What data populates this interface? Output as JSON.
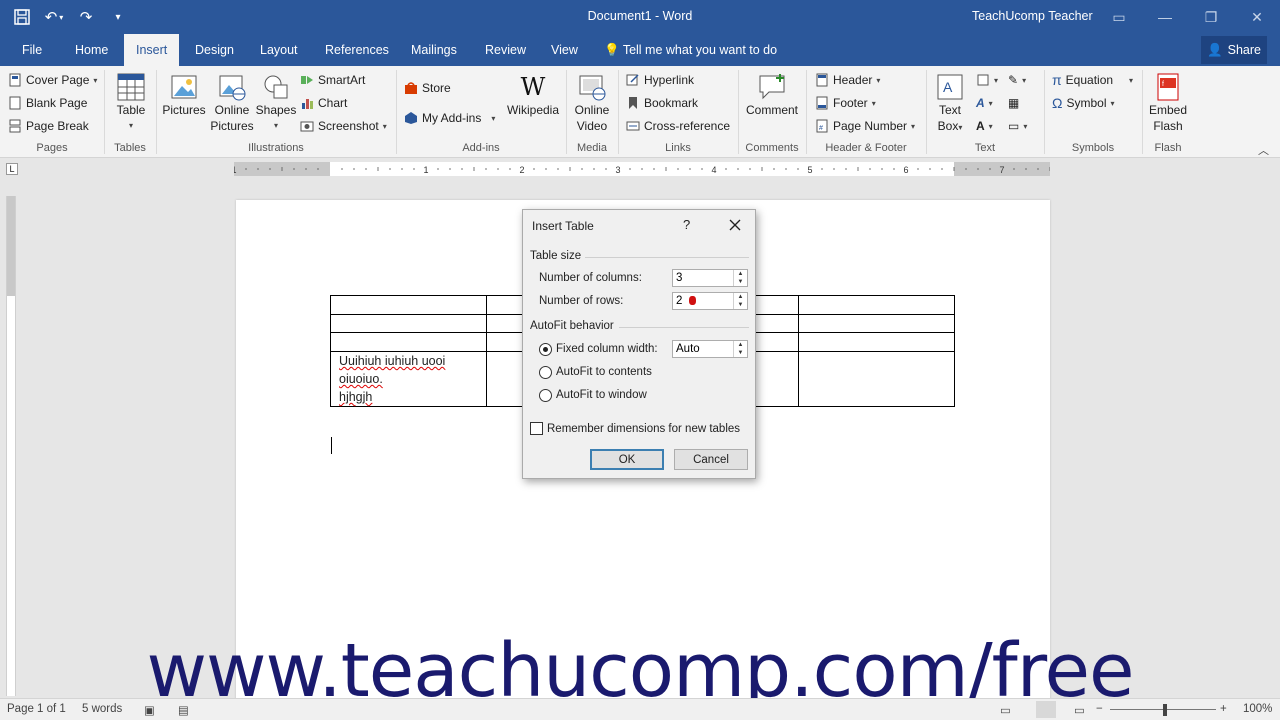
{
  "window": {
    "doc_title": "Document1 - Word",
    "user": "TeachUcomp Teacher"
  },
  "tabs": [
    "File",
    "Home",
    "Insert",
    "Design",
    "Layout",
    "References",
    "Mailings",
    "Review",
    "View"
  ],
  "active_tab": "Insert",
  "tell_me": "Tell me what you want to do",
  "share": "Share",
  "ribbon": {
    "pages": {
      "label": "Pages",
      "cover_page": "Cover Page",
      "blank_page": "Blank Page",
      "page_break": "Page Break"
    },
    "tables": {
      "label": "Tables",
      "table": "Table"
    },
    "illustrations": {
      "label": "Illustrations",
      "pictures": "Pictures",
      "online_pictures_1": "Online",
      "online_pictures_2": "Pictures",
      "shapes": "Shapes",
      "smartart": "SmartArt",
      "chart": "Chart",
      "screenshot": "Screenshot"
    },
    "addins": {
      "label": "Add-ins",
      "store": "Store",
      "my_addins": "My Add-ins",
      "wikipedia": "Wikipedia"
    },
    "media": {
      "label": "Media",
      "online_video_1": "Online",
      "online_video_2": "Video"
    },
    "links": {
      "label": "Links",
      "hyperlink": "Hyperlink",
      "bookmark": "Bookmark",
      "cross_reference": "Cross-reference"
    },
    "comments": {
      "label": "Comments",
      "comment": "Comment"
    },
    "header_footer": {
      "label": "Header & Footer",
      "header": "Header",
      "footer": "Footer",
      "page_number": "Page Number"
    },
    "text": {
      "label": "Text",
      "text_box_1": "Text",
      "text_box_2": "Box"
    },
    "symbols": {
      "label": "Symbols",
      "equation": "Equation",
      "symbol": "Symbol"
    },
    "flash": {
      "label": "Flash",
      "embed_flash_1": "Embed",
      "embed_flash_2": "Flash"
    }
  },
  "ruler_numbers": [
    "1",
    "1",
    "2",
    "3",
    "4",
    "5",
    "6",
    "7"
  ],
  "document": {
    "cell_line1": "Uuihiuh iuhiuh uooi",
    "cell_line2": "oiuoiuo.",
    "cell_line3": "hjhgjh"
  },
  "dialog": {
    "title": "Insert Table",
    "help": "?",
    "table_size_label": "Table size",
    "columns_label": "Number of columns:",
    "columns_value": "3",
    "rows_label": "Number of rows:",
    "rows_value": "2",
    "autofit_label": "AutoFit behavior",
    "fixed_label": "Fixed column width:",
    "fixed_value": "Auto",
    "autofit_contents": "AutoFit to contents",
    "autofit_window": "AutoFit to window",
    "remember": "Remember dimensions for new tables",
    "ok": "OK",
    "cancel": "Cancel"
  },
  "status": {
    "page": "Page 1 of 1",
    "words": "5 words",
    "zoom": "100%"
  },
  "watermark": "www.teachucomp.com/free",
  "colors": {
    "word_blue": "#2b579a",
    "status_bg": "#f0f0f0",
    "watermark": "#1a1a6e"
  }
}
